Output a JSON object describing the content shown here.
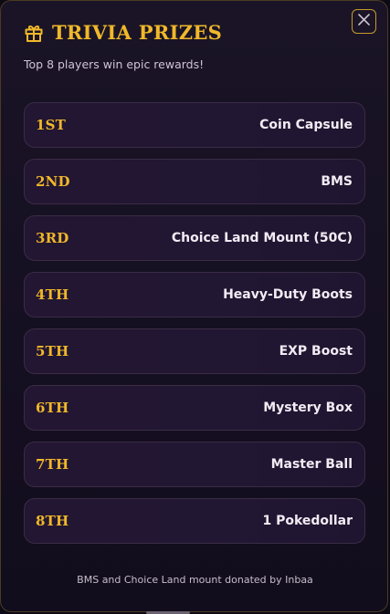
{
  "modal": {
    "title": "TRIVIA PRIZES",
    "subtitle": "Top 8 players win epic rewards!",
    "title_icon": "gift-icon",
    "close_icon": "close-icon",
    "accent_color": "#f0b82a",
    "footer": "BMS and Choice Land mount donated by Inbaa"
  },
  "prizes": [
    {
      "rank": "1ST",
      "reward": "Coin Capsule"
    },
    {
      "rank": "2ND",
      "reward": "BMS"
    },
    {
      "rank": "3RD",
      "reward": "Choice Land Mount (50C)"
    },
    {
      "rank": "4TH",
      "reward": "Heavy-Duty Boots"
    },
    {
      "rank": "5TH",
      "reward": "EXP Boost"
    },
    {
      "rank": "6TH",
      "reward": "Mystery Box"
    },
    {
      "rank": "7TH",
      "reward": "Master Ball"
    },
    {
      "rank": "8TH",
      "reward": "1 Pokedollar"
    }
  ]
}
